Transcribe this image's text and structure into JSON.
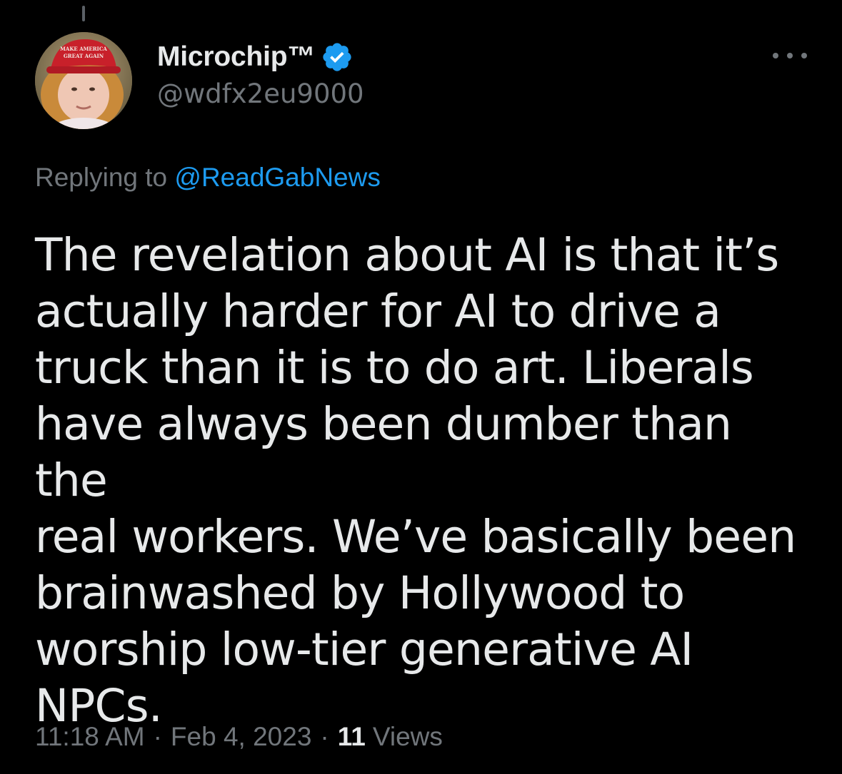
{
  "tweet": {
    "author": {
      "display_name": "Microchip™",
      "handle": "@wdfx2eu9000",
      "verified": true,
      "avatar_hat_text": [
        "MAKE AMERICA",
        "GREAT AGAIN"
      ]
    },
    "reply_prefix": "Replying to",
    "reply_handle": "@ReadGabNews",
    "text": "The revelation about AI is that it’s\nactually harder for AI to drive a\ntruck than it is to do art. Liberals\nhave always been dumber than the\nreal workers. We’ve basically been\nbrainwashed by Hollywood to\nworship low-tier generative AI\nNPCs.",
    "time": "11:18 AM",
    "date": "Feb 4, 2023",
    "separator": "·",
    "views_count": "11",
    "views_label": "Views"
  },
  "colors": {
    "background": "#000000",
    "text_primary": "#e7e9ea",
    "text_secondary": "#71767b",
    "accent": "#1d9bf0"
  },
  "icons": {
    "verified": "verified-badge-icon",
    "more": "more-options-icon"
  }
}
